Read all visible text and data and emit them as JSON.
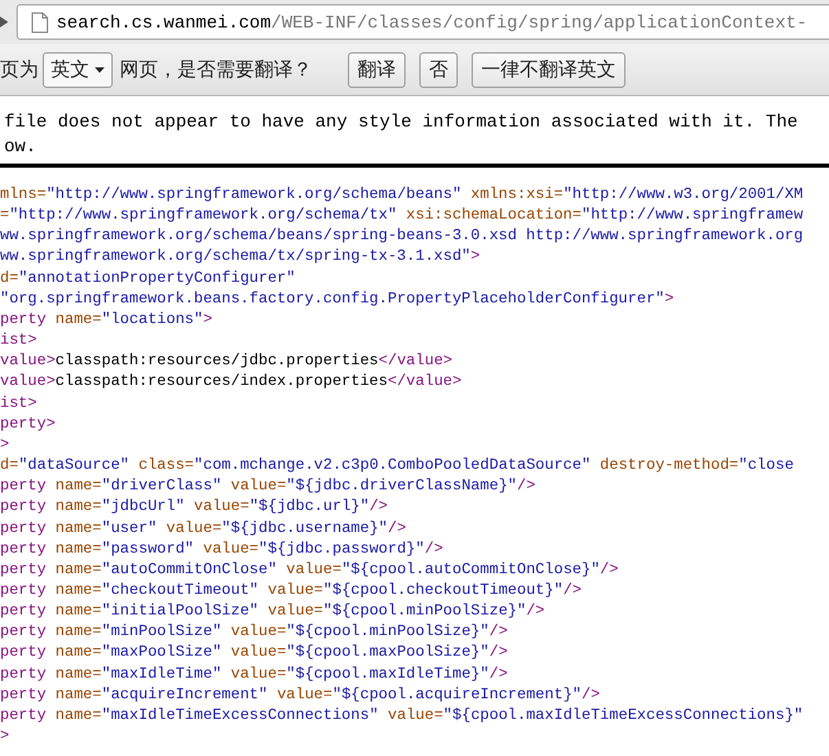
{
  "address_bar": {
    "host": "search.cs.wanmei.com",
    "path": "/WEB-INF/classes/config/spring/applicationContext-"
  },
  "translate_bar": {
    "prefix": "页为",
    "language_select": "英文",
    "question": "网页，是否需要翻译？",
    "buttons": [
      "翻译",
      "否",
      "一律不翻译英文"
    ]
  },
  "notice": {
    "lines": [
      "file does not appear to have any style information associated with it. The",
      "ow."
    ]
  },
  "xml_lines": [
    [
      {
        "kind": "attr",
        "text": "mlns="
      },
      {
        "kind": "value",
        "text": "\"http://www.springframework.org/schema/beans\""
      },
      {
        "kind": "attr",
        "text": " xmlns:xsi="
      },
      {
        "kind": "value",
        "text": "\"http://www.w3.org/2001/XM"
      }
    ],
    [
      {
        "kind": "attr",
        "text": "="
      },
      {
        "kind": "value",
        "text": "\"http://www.springframework.org/schema/tx\""
      },
      {
        "kind": "attr",
        "text": " xsi:schemaLocation="
      },
      {
        "kind": "value",
        "text": "\"http://www.springframew"
      }
    ],
    [
      {
        "kind": "value",
        "text": "ww.springframework.org/schema/beans/spring-beans-3.0.xsd http://www.springframework.org"
      }
    ],
    [
      {
        "kind": "value",
        "text": "ww.springframework.org/schema/tx/spring-tx-3.1.xsd\""
      },
      {
        "kind": "tag",
        "text": ">"
      }
    ],
    [
      {
        "kind": "attr",
        "text": "d="
      },
      {
        "kind": "value",
        "text": "\"annotationPropertyConfigurer\""
      }
    ],
    [
      {
        "kind": "value",
        "text": "\"org.springframework.beans.factory.config.PropertyPlaceholderConfigurer\""
      },
      {
        "kind": "tag",
        "text": ">"
      }
    ],
    [
      {
        "kind": "tag",
        "text": "perty"
      },
      {
        "kind": "attr",
        "text": " name="
      },
      {
        "kind": "value",
        "text": "\"locations\""
      },
      {
        "kind": "tag",
        "text": ">"
      }
    ],
    [
      {
        "kind": "tag",
        "text": "ist>"
      }
    ],
    [
      {
        "kind": "tag",
        "text": "value>"
      },
      {
        "kind": "text",
        "text": "classpath:resources/jdbc.properties"
      },
      {
        "kind": "tag",
        "text": "</value>"
      }
    ],
    [
      {
        "kind": "tag",
        "text": "value>"
      },
      {
        "kind": "text",
        "text": "classpath:resources/index.properties"
      },
      {
        "kind": "tag",
        "text": "</value>"
      }
    ],
    [
      {
        "kind": "tag",
        "text": "ist>"
      }
    ],
    [
      {
        "kind": "tag",
        "text": "perty>"
      }
    ],
    [
      {
        "kind": "tag",
        "text": ">"
      }
    ],
    [
      {
        "kind": "attr",
        "text": "d="
      },
      {
        "kind": "value",
        "text": "\"dataSource\""
      },
      {
        "kind": "attr",
        "text": " class="
      },
      {
        "kind": "value",
        "text": "\"com.mchange.v2.c3p0.ComboPooledDataSource\""
      },
      {
        "kind": "attr",
        "text": " destroy-method="
      },
      {
        "kind": "value",
        "text": "\"close"
      }
    ],
    [
      {
        "kind": "tag",
        "text": "perty"
      },
      {
        "kind": "attr",
        "text": " name="
      },
      {
        "kind": "value",
        "text": "\"driverClass\""
      },
      {
        "kind": "attr",
        "text": " value="
      },
      {
        "kind": "value",
        "text": "\"${jdbc.driverClassName}\""
      },
      {
        "kind": "tag",
        "text": "/>"
      }
    ],
    [
      {
        "kind": "tag",
        "text": "perty"
      },
      {
        "kind": "attr",
        "text": " name="
      },
      {
        "kind": "value",
        "text": "\"jdbcUrl\""
      },
      {
        "kind": "attr",
        "text": " value="
      },
      {
        "kind": "value",
        "text": "\"${jdbc.url}\""
      },
      {
        "kind": "tag",
        "text": "/>"
      }
    ],
    [
      {
        "kind": "tag",
        "text": "perty"
      },
      {
        "kind": "attr",
        "text": " name="
      },
      {
        "kind": "value",
        "text": "\"user\""
      },
      {
        "kind": "attr",
        "text": " value="
      },
      {
        "kind": "value",
        "text": "\"${jdbc.username}\""
      },
      {
        "kind": "tag",
        "text": "/>"
      }
    ],
    [
      {
        "kind": "tag",
        "text": "perty"
      },
      {
        "kind": "attr",
        "text": " name="
      },
      {
        "kind": "value",
        "text": "\"password\""
      },
      {
        "kind": "attr",
        "text": " value="
      },
      {
        "kind": "value",
        "text": "\"${jdbc.password}\""
      },
      {
        "kind": "tag",
        "text": "/>"
      }
    ],
    [
      {
        "kind": "tag",
        "text": "perty"
      },
      {
        "kind": "attr",
        "text": " name="
      },
      {
        "kind": "value",
        "text": "\"autoCommitOnClose\""
      },
      {
        "kind": "attr",
        "text": " value="
      },
      {
        "kind": "value",
        "text": "\"${cpool.autoCommitOnClose}\""
      },
      {
        "kind": "tag",
        "text": "/>"
      }
    ],
    [
      {
        "kind": "tag",
        "text": "perty"
      },
      {
        "kind": "attr",
        "text": " name="
      },
      {
        "kind": "value",
        "text": "\"checkoutTimeout\""
      },
      {
        "kind": "attr",
        "text": " value="
      },
      {
        "kind": "value",
        "text": "\"${cpool.checkoutTimeout}\""
      },
      {
        "kind": "tag",
        "text": "/>"
      }
    ],
    [
      {
        "kind": "tag",
        "text": "perty"
      },
      {
        "kind": "attr",
        "text": " name="
      },
      {
        "kind": "value",
        "text": "\"initialPoolSize\""
      },
      {
        "kind": "attr",
        "text": " value="
      },
      {
        "kind": "value",
        "text": "\"${cpool.minPoolSize}\""
      },
      {
        "kind": "tag",
        "text": "/>"
      }
    ],
    [
      {
        "kind": "tag",
        "text": "perty"
      },
      {
        "kind": "attr",
        "text": " name="
      },
      {
        "kind": "value",
        "text": "\"minPoolSize\""
      },
      {
        "kind": "attr",
        "text": " value="
      },
      {
        "kind": "value",
        "text": "\"${cpool.minPoolSize}\""
      },
      {
        "kind": "tag",
        "text": "/>"
      }
    ],
    [
      {
        "kind": "tag",
        "text": "perty"
      },
      {
        "kind": "attr",
        "text": " name="
      },
      {
        "kind": "value",
        "text": "\"maxPoolSize\""
      },
      {
        "kind": "attr",
        "text": " value="
      },
      {
        "kind": "value",
        "text": "\"${cpool.maxPoolSize}\""
      },
      {
        "kind": "tag",
        "text": "/>"
      }
    ],
    [
      {
        "kind": "tag",
        "text": "perty"
      },
      {
        "kind": "attr",
        "text": " name="
      },
      {
        "kind": "value",
        "text": "\"maxIdleTime\""
      },
      {
        "kind": "attr",
        "text": " value="
      },
      {
        "kind": "value",
        "text": "\"${cpool.maxIdleTime}\""
      },
      {
        "kind": "tag",
        "text": "/>"
      }
    ],
    [
      {
        "kind": "tag",
        "text": "perty"
      },
      {
        "kind": "attr",
        "text": " name="
      },
      {
        "kind": "value",
        "text": "\"acquireIncrement\""
      },
      {
        "kind": "attr",
        "text": " value="
      },
      {
        "kind": "value",
        "text": "\"${cpool.acquireIncrement}\""
      },
      {
        "kind": "tag",
        "text": "/>"
      }
    ],
    [
      {
        "kind": "tag",
        "text": "perty"
      },
      {
        "kind": "attr",
        "text": " name="
      },
      {
        "kind": "value",
        "text": "\"maxIdleTimeExcessConnections\""
      },
      {
        "kind": "attr",
        "text": " value="
      },
      {
        "kind": "value",
        "text": "\"${cpool.maxIdleTimeExcessConnections}\""
      }
    ],
    [
      {
        "kind": "tag",
        "text": ">"
      }
    ]
  ]
}
